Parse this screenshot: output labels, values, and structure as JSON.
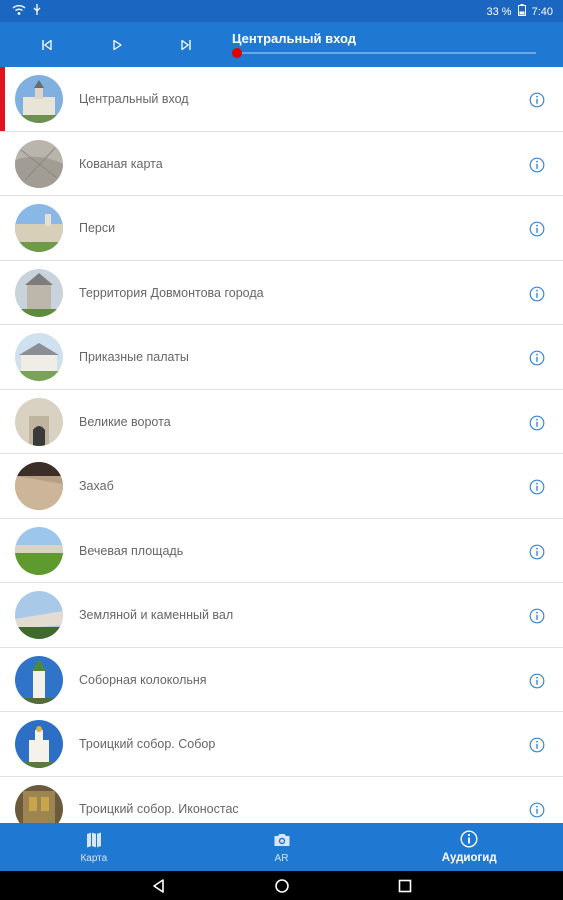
{
  "status_bar": {
    "battery": "33 %",
    "time": "7:40"
  },
  "player": {
    "now_playing": "Центральный вход",
    "progress": 0.0
  },
  "list": [
    {
      "label": "Центральный вход",
      "active": true
    },
    {
      "label": "Кованая карта"
    },
    {
      "label": "Перси"
    },
    {
      "label": "Территория Довмонтова города"
    },
    {
      "label": "Приказные палаты"
    },
    {
      "label": "Великие ворота"
    },
    {
      "label": "Захаб"
    },
    {
      "label": "Вечевая площадь"
    },
    {
      "label": "Земляной и каменный вал"
    },
    {
      "label": "Соборная колокольня"
    },
    {
      "label": "Троицкий собор. Собор"
    },
    {
      "label": "Троицкий собор. Иконостас"
    }
  ],
  "nav": {
    "map_label": "Карта",
    "ar_label": "AR",
    "audio_label": "Аудиогид",
    "active": "audio"
  },
  "colors": {
    "primary": "#1f78d1",
    "status": "#1a66c0",
    "accent": "#e0141e",
    "info_icon": "#3a86d6"
  }
}
